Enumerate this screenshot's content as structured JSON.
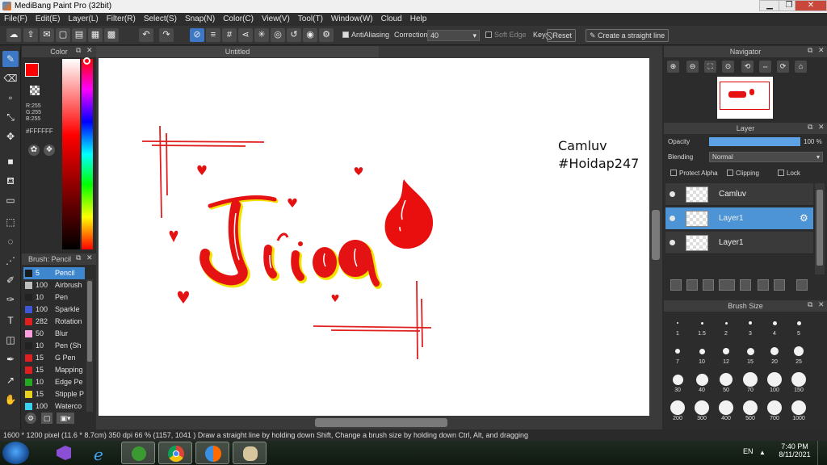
{
  "window": {
    "title": "MediBang Paint Pro (32bit)",
    "minimize_glyph": "▁",
    "restore_glyph": "❐",
    "close_glyph": "✕"
  },
  "menu": [
    "File(F)",
    "Edit(E)",
    "Layer(L)",
    "Filter(R)",
    "Select(S)",
    "Snap(N)",
    "Color(C)",
    "View(V)",
    "Tool(T)",
    "Window(W)",
    "Cloud",
    "Help"
  ],
  "toolbar": {
    "antialiasing_label": "AntiAliasing",
    "antialiasing_checked": true,
    "correction_label": "Correction",
    "correction_value": "40",
    "soft_edge_label": "Soft Edge",
    "soft_edge_checked": false,
    "key_label": "Key",
    "reset_label": "Reset",
    "straight_line_label": "Create a straight line"
  },
  "color_panel": {
    "title": "Color",
    "r": "R:255",
    "g": "G:255",
    "b": "B:255",
    "hex": "#FFFFFF",
    "foreground": "#ff0000",
    "background": "#ffffff"
  },
  "brush_panel": {
    "title": "Brush: Pencil",
    "items": [
      {
        "size": "5",
        "name": "Pencil",
        "color": "#1a1a1a",
        "selected": true
      },
      {
        "size": "100",
        "name": "Airbrush",
        "color": "#bdbdbd"
      },
      {
        "size": "10",
        "name": "Pen",
        "color": "#222222"
      },
      {
        "size": "100",
        "name": "Sparkle",
        "color": "#3f57d6"
      },
      {
        "size": "282",
        "name": "Rotation",
        "color": "#e02020"
      },
      {
        "size": "50",
        "name": "Blur",
        "color": "#ff9ee0"
      },
      {
        "size": "10",
        "name": "Pen (Sh",
        "color": "#222222"
      },
      {
        "size": "15",
        "name": "G Pen",
        "color": "#e02020"
      },
      {
        "size": "15",
        "name": "Mapping",
        "color": "#e02020"
      },
      {
        "size": "10",
        "name": "Edge Pe",
        "color": "#22aa22"
      },
      {
        "size": "15",
        "name": "Stipple P",
        "color": "#e8d020"
      },
      {
        "size": "100",
        "name": "Waterco",
        "color": "#3ad0f0"
      }
    ]
  },
  "canvas": {
    "tab": "Untitled",
    "text_line1": "Camluv",
    "text_line2": "#Hoidap247"
  },
  "navigator": {
    "title": "Navigator"
  },
  "layer_panel": {
    "title": "Layer",
    "opacity_label": "Opacity",
    "opacity_value": "100 %",
    "opacity_fraction": 1.0,
    "blending_label": "Blending",
    "blending_value": "Normal",
    "protect_alpha": "Protect Alpha",
    "clipping": "Clipping",
    "lock": "Lock",
    "layers": [
      {
        "name": "Camluv",
        "selected": false
      },
      {
        "name": "Layer1",
        "selected": true
      },
      {
        "name": "Layer1",
        "selected": false
      }
    ]
  },
  "brush_size": {
    "title": "Brush Size",
    "sizes": [
      "1",
      "1.5",
      "2",
      "3",
      "4",
      "5",
      "7",
      "10",
      "12",
      "15",
      "20",
      "25",
      "30",
      "40",
      "50",
      "70",
      "100",
      "150",
      "200",
      "300",
      "400",
      "500",
      "700",
      "1000"
    ]
  },
  "status": {
    "text": "1600 * 1200 pixel   (11.6 * 8.7cm)   350 dpi   66 %   (1157, 1041 )   Draw a straight line by holding down Shift, Change a brush size by holding down Ctrl, Alt, and dragging"
  },
  "taskbar": {
    "language": "EN",
    "time": "7:40 PM",
    "date": "8/11/2021"
  }
}
